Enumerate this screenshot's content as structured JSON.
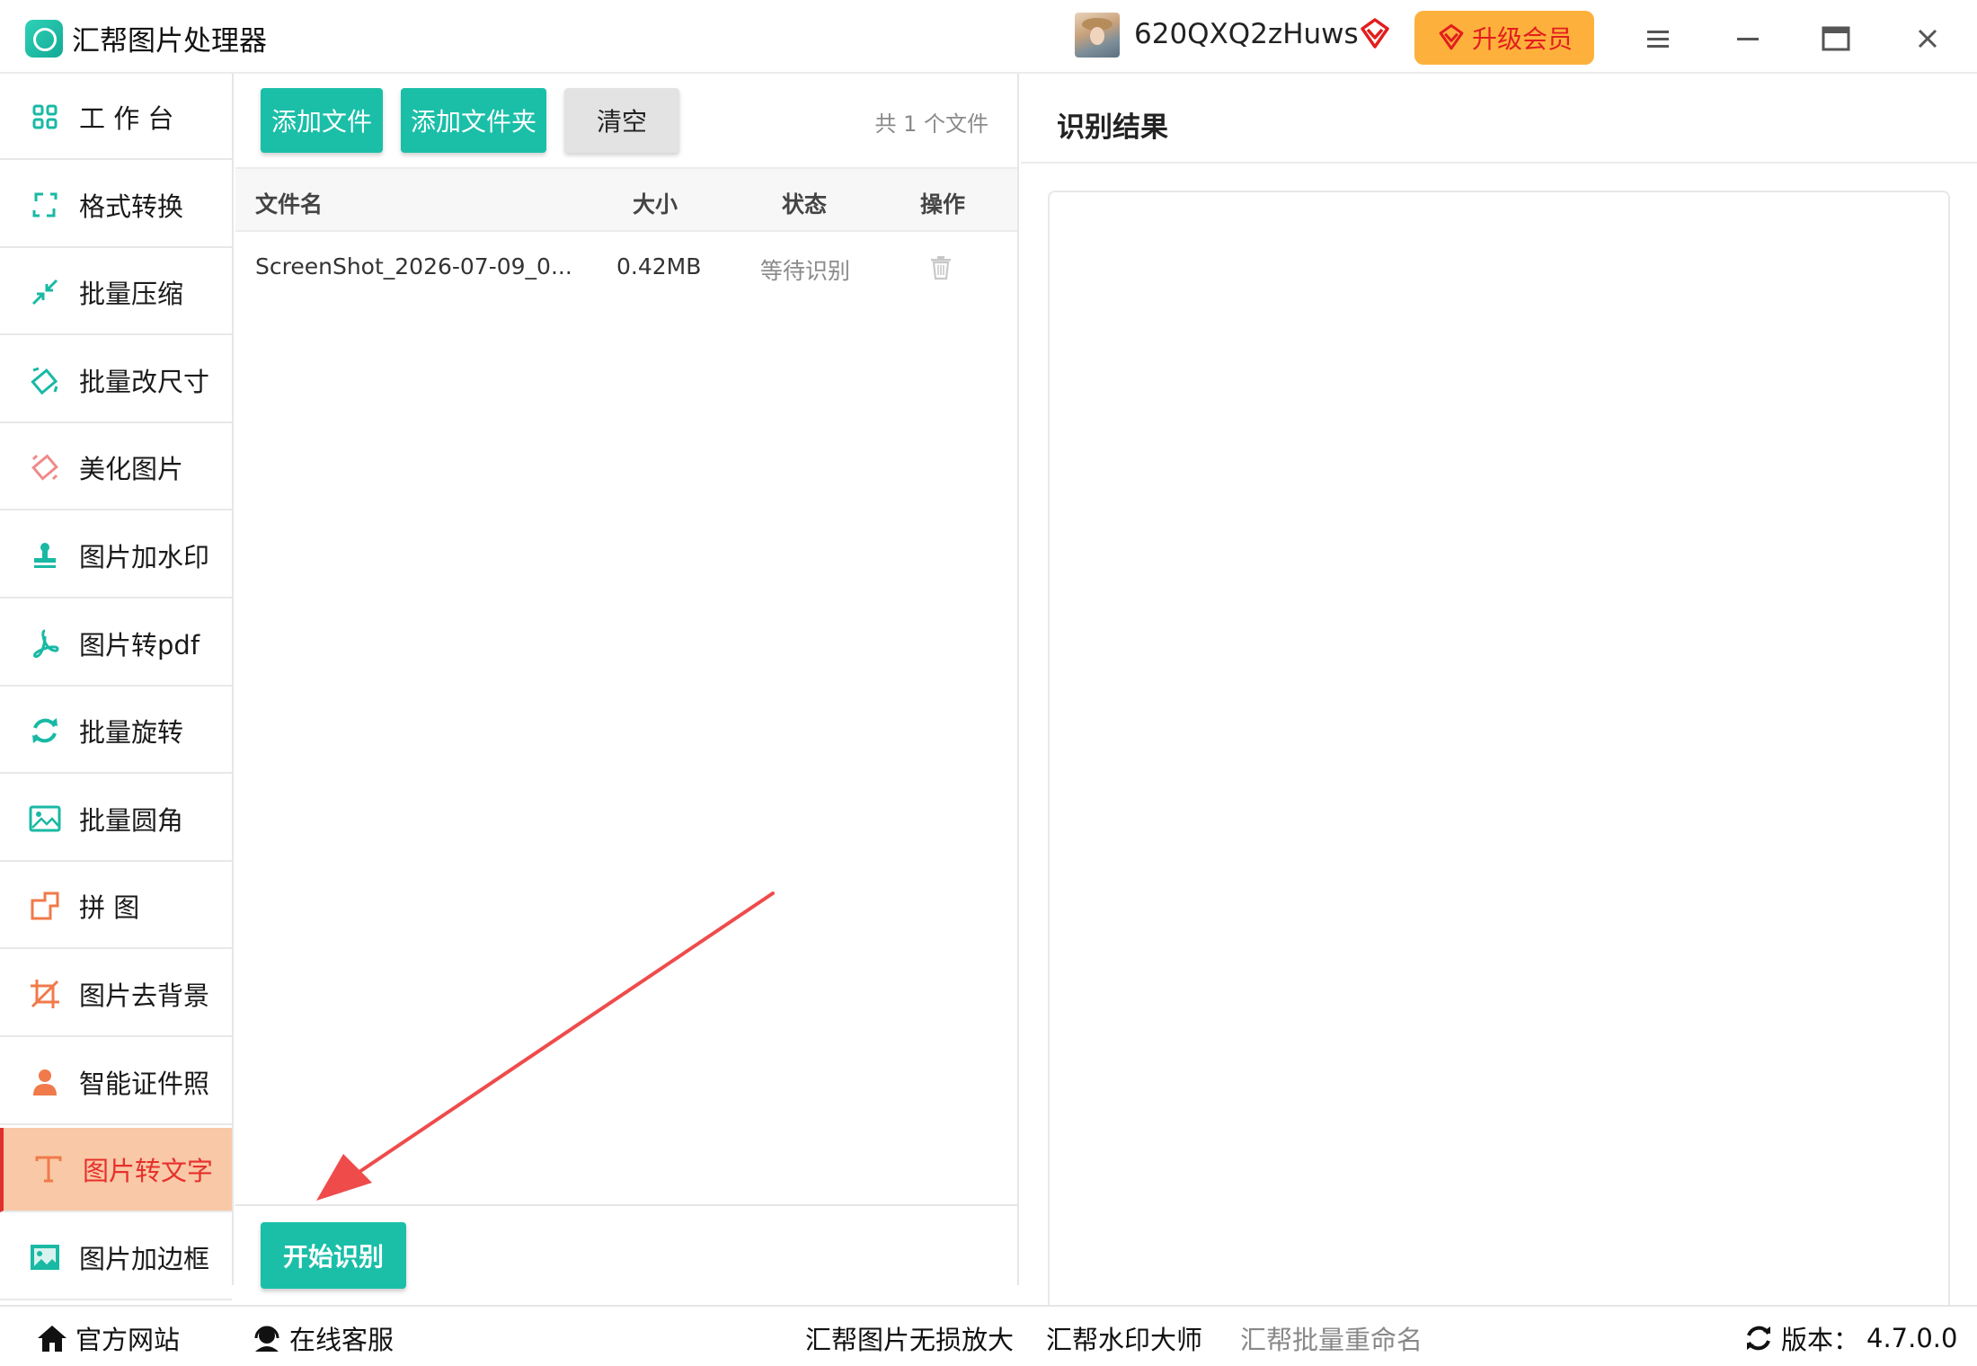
{
  "titlebar": {
    "app_title": "汇帮图片处理器",
    "username": "620QXQ2zHuws",
    "upgrade_label": "升级会员"
  },
  "sidebar": {
    "items": [
      {
        "label": "工 作 台",
        "icon": "grid-icon"
      },
      {
        "label": "格式转换",
        "icon": "convert-icon"
      },
      {
        "label": "批量压缩",
        "icon": "compress-icon"
      },
      {
        "label": "批量改尺寸",
        "icon": "resize-icon"
      },
      {
        "label": "美化图片",
        "icon": "beautify-icon"
      },
      {
        "label": "图片加水印",
        "icon": "stamp-icon"
      },
      {
        "label": "图片转pdf",
        "icon": "pdf-icon"
      },
      {
        "label": "批量旋转",
        "icon": "rotate-icon"
      },
      {
        "label": "批量圆角",
        "icon": "image-icon"
      },
      {
        "label": "拼    图",
        "icon": "puzzle-icon"
      },
      {
        "label": "图片去背景",
        "icon": "crop-icon"
      },
      {
        "label": "智能证件照",
        "icon": "person-icon"
      },
      {
        "label": "图片转文字",
        "icon": "text-icon"
      },
      {
        "label": "图片加边框",
        "icon": "frame-icon"
      }
    ],
    "active_index": 12
  },
  "file_panel": {
    "add_file_label": "添加文件",
    "add_folder_label": "添加文件夹",
    "clear_label": "清空",
    "file_count": "共 1 个文件",
    "columns": [
      "文件名",
      "大小",
      "状态",
      "操作"
    ],
    "rows": [
      {
        "name": "ScreenShot_2026-07-09_0...",
        "size": "0.42MB",
        "status": "等待识别"
      }
    ],
    "start_label": "开始识别"
  },
  "result_panel": {
    "title": "识别结果"
  },
  "footer": {
    "website": "官方网站",
    "support": "在线客服",
    "link1": "汇帮图片无损放大",
    "link2": "汇帮水印大师",
    "link3": "汇帮批量重命名",
    "version_label": "版本：",
    "version": "4.7.0.0"
  },
  "colors": {
    "accent": "#1bbfa8",
    "active_bg": "#f9c8a6",
    "active_text": "#e6302c",
    "upgrade_bg": "#fdb13c",
    "arrow": "#ef4b4b"
  }
}
